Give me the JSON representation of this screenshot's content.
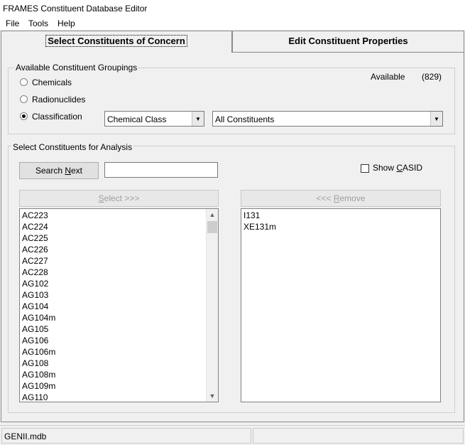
{
  "window": {
    "title": "FRAMES Constituent Database Editor"
  },
  "menu": {
    "items": [
      "File",
      "Tools",
      "Help"
    ]
  },
  "tabs": [
    {
      "label": "Select Constituents of Concern",
      "active": true
    },
    {
      "label": "Edit Constituent Properties",
      "active": false
    }
  ],
  "groupings": {
    "legend": "Available Constituent Groupings",
    "available_label": "Available",
    "available_count": "(829)",
    "radios": [
      {
        "label": "Chemicals",
        "checked": false
      },
      {
        "label": "Radionuclides",
        "checked": false
      },
      {
        "label": "Classification",
        "checked": true
      }
    ],
    "class_combo": "Chemical Class",
    "constituent_combo": "All Constituents"
  },
  "analysis": {
    "legend": "Select Constituents for Analysis",
    "search_button": "Search Next",
    "search_value": "",
    "show_casid_label": "Show CASID",
    "show_casid_checked": false,
    "select_button": "Select >>>",
    "remove_button": "<<< Remove",
    "available_list": [
      "AC223",
      "AC224",
      "AC225",
      "AC226",
      "AC227",
      "AC228",
      "AG102",
      "AG103",
      "AG104",
      "AG104m",
      "AG105",
      "AG106",
      "AG106m",
      "AG108",
      "AG108m",
      "AG109m",
      "AG110"
    ],
    "selected_list": [
      "I131",
      "XE131m"
    ]
  },
  "status": {
    "file": "GENII.mdb",
    "second": ""
  }
}
